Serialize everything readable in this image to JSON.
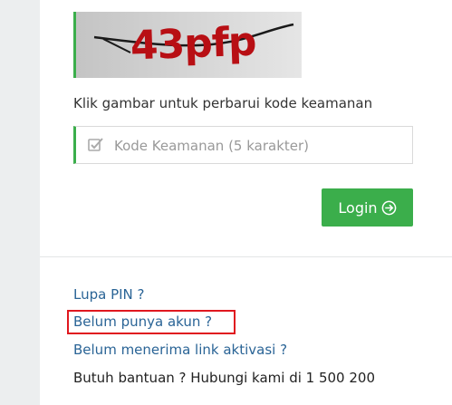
{
  "captcha": {
    "text": "43pfp",
    "icon": "captcha-image"
  },
  "hint": "Klik gambar untuk perbarui kode keamanan",
  "security_input": {
    "placeholder": "Kode Keamanan (5 karakter)",
    "value": "",
    "icon": "checkbox-edit-icon"
  },
  "login_button": {
    "label": "Login",
    "icon": "circle-arrow-right-icon"
  },
  "links": {
    "forgot_pin": "Lupa PIN ?",
    "no_account": "Belum punya akun ?",
    "no_activation": "Belum menerima link aktivasi ?"
  },
  "help_text": "Butuh bantuan ? Hubungi kami di 1 500 200",
  "colors": {
    "accent": "#3bae4b",
    "link": "#2a6496",
    "highlight": "#e0181f",
    "captcha_text": "#b80f14"
  }
}
